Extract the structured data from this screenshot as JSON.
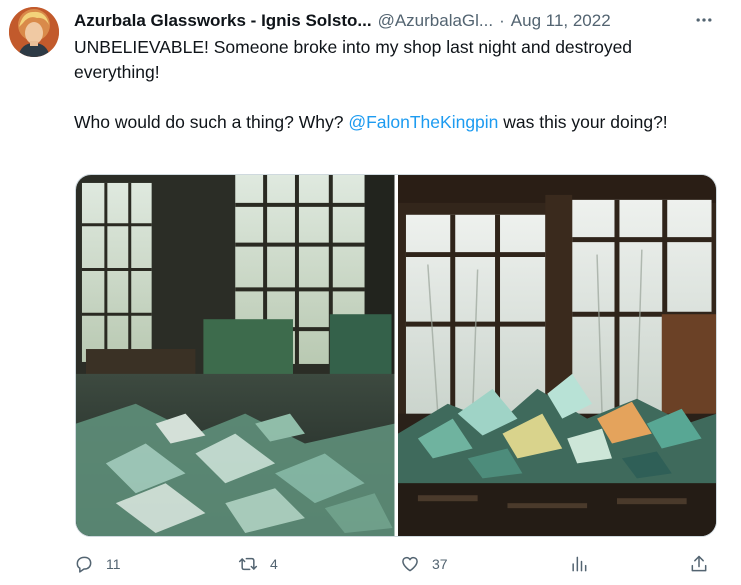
{
  "tweet": {
    "author_name": "Azurbala Glassworks - Ignis Solsto...",
    "author_handle": "@AzurbalaGl...",
    "separator": "·",
    "date": "Aug 11, 2022",
    "text_line1": "UNBELIEVABLE!  Someone broke into my shop last night and destroyed everything!",
    "text_line2_before": "Who would do such a thing?  Why? ",
    "mention": "@FalonTheKingpin",
    "text_line2_after": " was this your doing?!"
  },
  "actions": {
    "reply_count": "11",
    "retweet_count": "4",
    "like_count": "37"
  },
  "icons": {
    "reply": "reply-icon",
    "retweet": "retweet-icon",
    "like": "heart-icon",
    "views": "views-icon",
    "share": "share-icon",
    "more": "more-icon"
  },
  "colors": {
    "accent": "#1d9bf0",
    "text_primary": "#0f1419",
    "text_secondary": "#536471",
    "border": "#cfd9de"
  }
}
